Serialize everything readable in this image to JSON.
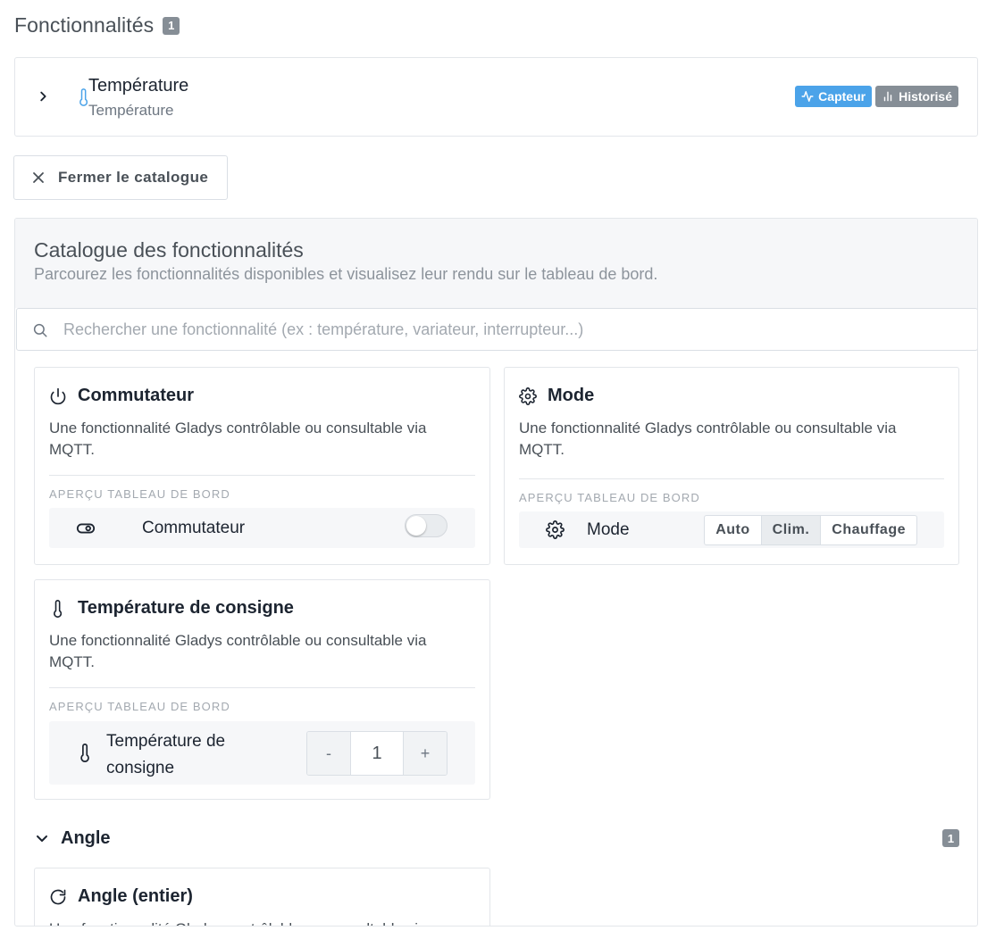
{
  "section": {
    "title": "Fonctionnalités",
    "count": "1"
  },
  "feature": {
    "title": "Température",
    "subtitle": "Température",
    "tags": [
      {
        "label": "Capteur",
        "icon": "activity-icon",
        "color": "#4ba3e9"
      },
      {
        "label": "Historisé",
        "icon": "bar-chart-icon",
        "color": "#868e96"
      }
    ]
  },
  "close_button": {
    "label": "Fermer le catalogue"
  },
  "catalogue": {
    "title": "Catalogue des fonctionnalités",
    "subtitle": "Parcourez les fonctionnalités disponibles et visualisez leur rendu sur le tableau de bord.",
    "search_placeholder": "Rechercher une fonctionnalité (ex : température, variateur, interrupteur...)",
    "preview_label": "APERÇU TABLEAU DE BORD",
    "cards": [
      {
        "title": "Commutateur",
        "icon": "power-icon",
        "description": "Une fonctionnalité Gladys contrôlable ou consultable via MQTT.",
        "preview_icon": "toggle-icon",
        "preview_name": "Commutateur",
        "control": "switch",
        "switch_on": false
      },
      {
        "title": "Mode",
        "icon": "gear-icon",
        "description": "Une fonctionnalité Gladys contrôlable ou consultable via MQTT.",
        "preview_icon": "gear-icon",
        "preview_name": "Mode",
        "control": "segmented",
        "options": [
          "Auto",
          "Clim.",
          "Chauffage"
        ],
        "selected": "Clim."
      },
      {
        "title": "Température de consigne",
        "icon": "thermometer-icon",
        "description": "Une fonctionnalité Gladys contrôlable ou consultable via MQTT.",
        "preview_icon": "thermometer-icon",
        "preview_name": "Température de consigne",
        "control": "stepper",
        "minus": "-",
        "value": "1",
        "plus": "+"
      }
    ],
    "group": {
      "name": "Angle",
      "count": "1"
    },
    "group_card": {
      "title": "Angle (entier)",
      "icon": "rotate-icon",
      "description": "Une fonctionnalité Gladys contrôlable ou consultable via MQTT."
    }
  },
  "colors": {
    "accent_blue": "#4ba3e9",
    "badge_gray": "#868e96",
    "panel_bg": "#f6f7f9"
  }
}
